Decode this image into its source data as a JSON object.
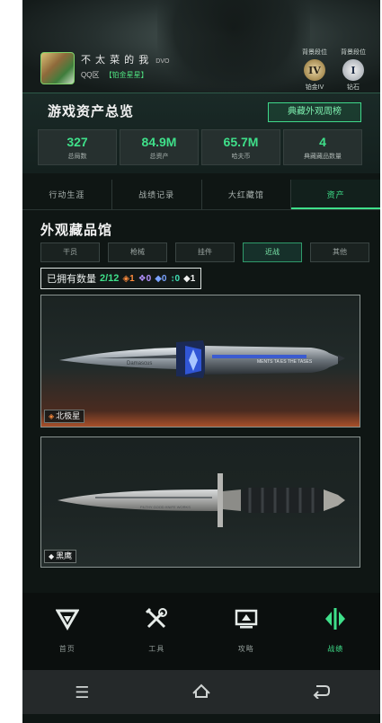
{
  "header": {
    "player_name": "不 太 菜 的 我",
    "player_suffix": "DVO",
    "qq_label": "QQ区",
    "qq_tag": "【铂金星星】",
    "ranks": [
      {
        "caption": "背景段位",
        "emblem": "IV",
        "label": "铂金IV"
      },
      {
        "caption": "背景段位",
        "emblem": "I",
        "label": "钻石"
      }
    ]
  },
  "overview": {
    "title": "游戏资产总览",
    "weekly_button": "典藏外观周榜",
    "stats": [
      {
        "value": "327",
        "label": "总局数"
      },
      {
        "value": "84.9M",
        "label": "总资产"
      },
      {
        "value": "65.7M",
        "label": "哈夫币"
      },
      {
        "value": "4",
        "label": "典藏藏品数量"
      }
    ]
  },
  "tabs": [
    {
      "label": "行动生涯",
      "active": false
    },
    {
      "label": "战绩记录",
      "active": false
    },
    {
      "label": "大红藏馆",
      "active": false
    },
    {
      "label": "资产",
      "active": true
    }
  ],
  "gallery": {
    "title": "外观藏品馆",
    "filters": [
      {
        "label": "干员",
        "active": false
      },
      {
        "label": "枪械",
        "active": false
      },
      {
        "label": "挂件",
        "active": false
      },
      {
        "label": "近战",
        "active": true
      },
      {
        "label": "其他",
        "active": false
      }
    ],
    "owned": {
      "label": "已拥有数量",
      "count": "2/12",
      "grades": [
        {
          "glyph": "◈",
          "value": "1",
          "color": "#ff8b3d"
        },
        {
          "glyph": "❖",
          "value": "0",
          "color": "#b592ff"
        },
        {
          "glyph": "◆",
          "value": "0",
          "color": "#7aa2ff"
        },
        {
          "glyph": "↕",
          "value": "0",
          "color": "#3fe0b5"
        },
        {
          "glyph": "◆",
          "value": "1",
          "color": "#f0f0f0"
        }
      ]
    },
    "items": [
      {
        "name": "北极星",
        "grade_glyph": "◈",
        "grade_color": "#ff8b3d"
      },
      {
        "name": "黑鹰",
        "grade_glyph": "◆",
        "grade_color": "#f0f0f0"
      }
    ]
  },
  "bottom_nav": [
    {
      "icon": "delta-logo-icon",
      "label": "首页",
      "active": false
    },
    {
      "icon": "tools-icon",
      "label": "工具",
      "active": false
    },
    {
      "icon": "monitor-icon",
      "label": "攻略",
      "active": false
    },
    {
      "icon": "assets-icon",
      "label": "战绩",
      "active": true
    }
  ],
  "system_bar": [
    "menu-icon",
    "home-icon",
    "back-icon"
  ]
}
